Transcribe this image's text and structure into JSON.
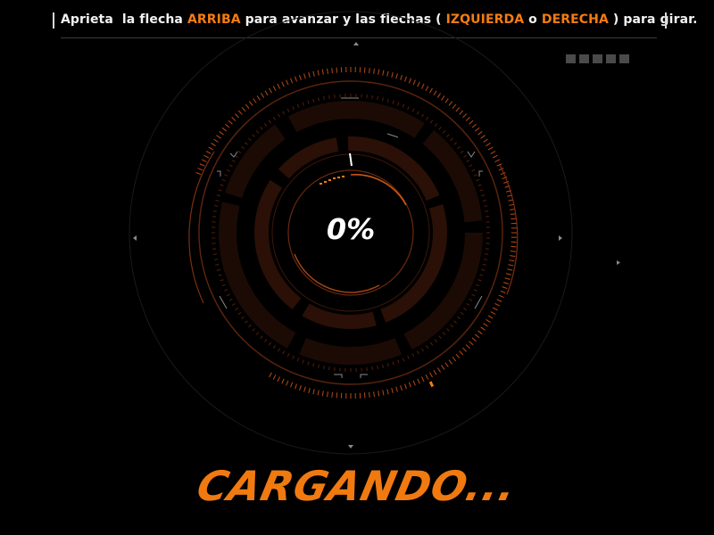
{
  "instructions": {
    "part1": "Aprieta  la flecha ",
    "key_up": "ARRIBA",
    "part2": " para avanzar y las flechas ( ",
    "key_left": "IZQUIERDA",
    "part3": " o ",
    "key_right": "DERECHA",
    "part4": " ) para girar."
  },
  "loader": {
    "percent_value": "0",
    "percent_sign": "%",
    "progress": 0,
    "title": "CARGANDO..."
  },
  "indicator_count": 5,
  "colors": {
    "accent": "#f47c12",
    "dark_ring": "#1e0c06",
    "tick": "#b84a14",
    "background": "#000000"
  }
}
